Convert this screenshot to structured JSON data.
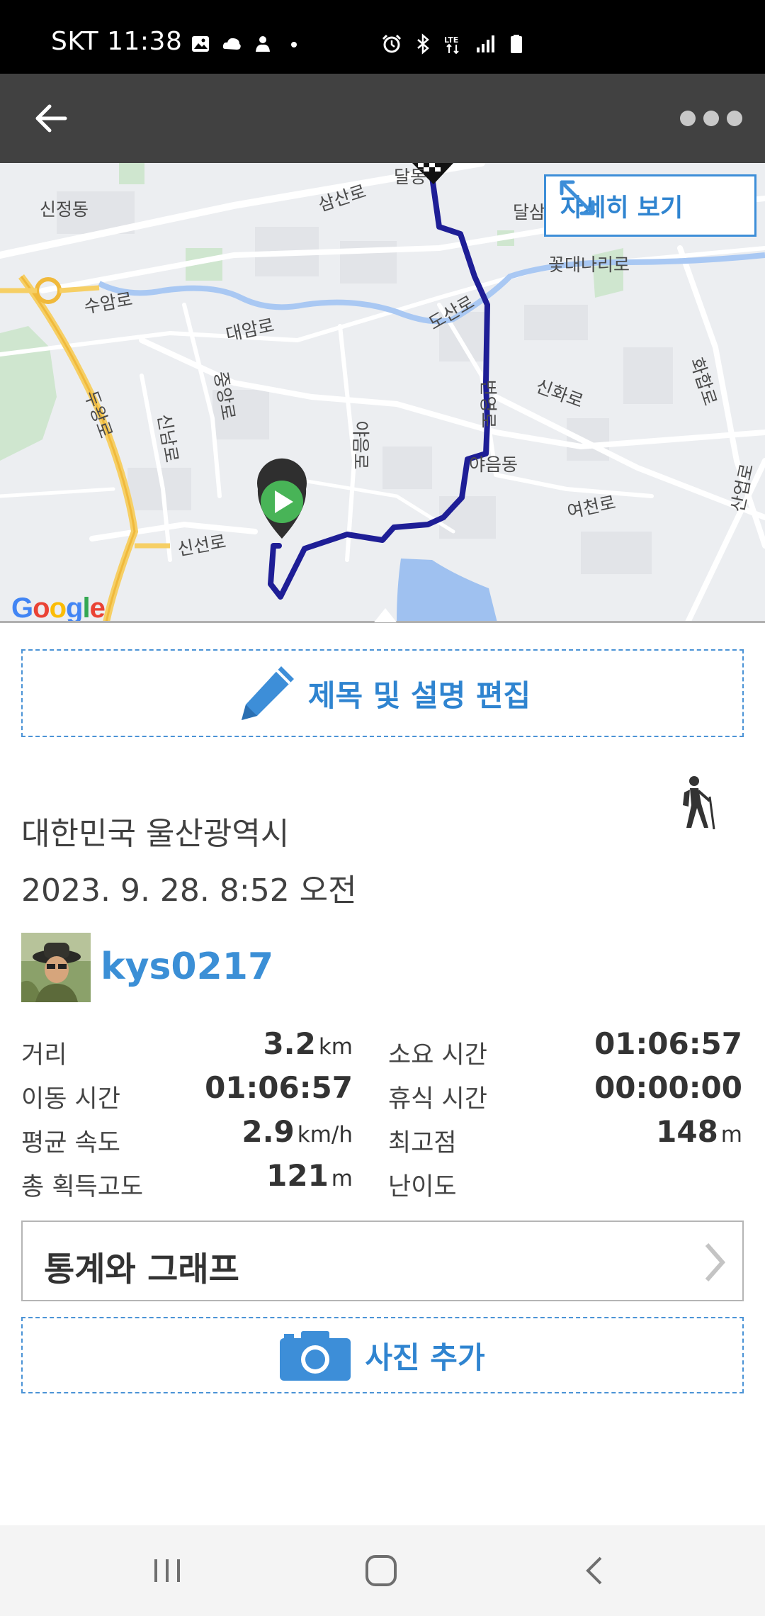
{
  "status_bar": {
    "time": "SKT 11:38",
    "left_icons": [
      "gallery-icon",
      "cloud-icon",
      "app-icon",
      "dot-icon"
    ],
    "right_icons": [
      "alarm-icon",
      "bluetooth-icon",
      "lte-icon",
      "signal-icon",
      "battery-icon"
    ]
  },
  "app_bar": {
    "back_icon": "arrow-left-icon",
    "more_icon": "more-dots-icon"
  },
  "map": {
    "detail_button_label": "자세히 보기",
    "provider_logo": "Google",
    "labels": {
      "sinjeong": "신정동",
      "samsan": "삼산로",
      "dal": "달동",
      "dalsam": "달삼",
      "kkotdae": "꽃대나리로",
      "suam": "수암로",
      "daeam": "대암로",
      "dosan": "도산로",
      "sinhwa": "신화로",
      "hwahap": "화합로",
      "dueong": "두왕로",
      "jungang": "중앙로",
      "sinnam": "신남로",
      "yaeum_ro": "야음로",
      "beonyeong": "번영로",
      "yaeum_dong": "야음동",
      "yeocheon": "여천로",
      "sanop": "산업로",
      "sinseon": "신선로"
    },
    "route_color": "#1e1e96",
    "start_marker_color": "#4caf50",
    "finish_marker": "checkered-flag"
  },
  "edit_button": {
    "label": "제목 및 설명 편집",
    "icon": "pencil-icon"
  },
  "activity": {
    "type_icon": "hiker-icon",
    "location": "대한민국 울산광역시",
    "datetime": "2023. 9. 28. 8:52 오전",
    "username": "kys0217"
  },
  "stats": {
    "distance_label": "거리",
    "distance_value": "3.2",
    "distance_unit": "km",
    "total_time_label": "소요 시간",
    "total_time_value": "01:06:57",
    "moving_time_label": "이동 시간",
    "moving_time_value": "01:06:57",
    "rest_time_label": "휴식 시간",
    "rest_time_value": "00:00:00",
    "avg_speed_label": "평균 속도",
    "avg_speed_value": "2.9",
    "avg_speed_unit": "km/h",
    "max_alt_label": "최고점",
    "max_alt_value": "148",
    "max_alt_unit": "m",
    "gain_label": "총 획득고도",
    "gain_value": "121",
    "gain_unit": "m",
    "difficulty_label": "난이도"
  },
  "graph_button": {
    "label": "통계와 그래프"
  },
  "photo_button": {
    "label": "사진 추가",
    "icon": "camera-icon"
  },
  "nav_bar": {
    "icons": [
      "recents-icon",
      "home-icon",
      "back-icon"
    ]
  },
  "colors": {
    "accent": "#2f84d0",
    "app_bar": "#414141",
    "route": "#1e1e96"
  }
}
